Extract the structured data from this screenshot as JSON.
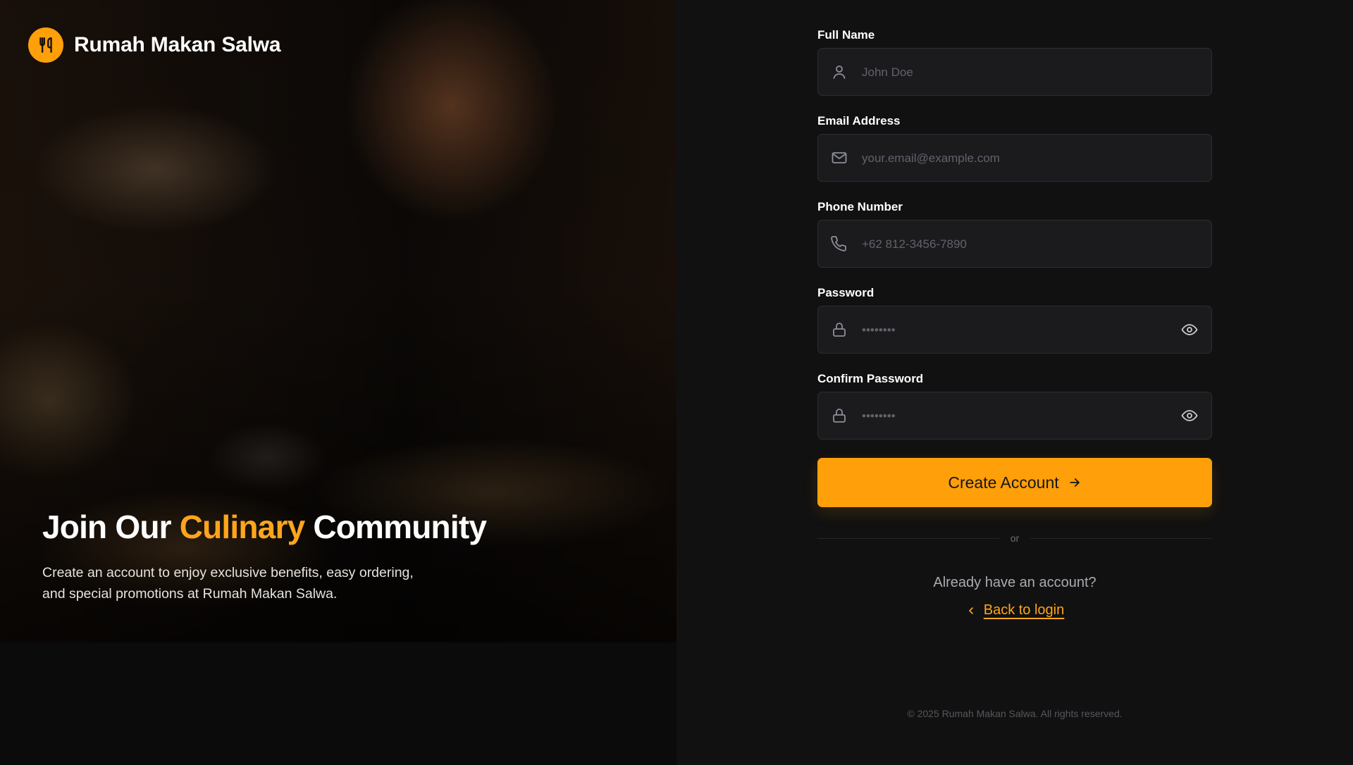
{
  "brand": {
    "name": "Rumah Makan Salwa",
    "logo_icon": "utensils-icon"
  },
  "hero": {
    "title_part1": "Join Our ",
    "title_accent": "Culinary",
    "title_part2": " Community",
    "subtitle_line1": "Create an account to enjoy exclusive benefits, easy ordering,",
    "subtitle_line2": "and special promotions at Rumah Makan Salwa."
  },
  "form": {
    "full_name": {
      "label": "Full Name",
      "placeholder": "John Doe",
      "icon": "user-icon"
    },
    "email": {
      "label": "Email Address",
      "placeholder": "your.email@example.com",
      "icon": "mail-icon"
    },
    "phone": {
      "label": "Phone Number",
      "placeholder": "+62 812-3456-7890",
      "icon": "phone-icon"
    },
    "password": {
      "label": "Password",
      "placeholder": "••••••••",
      "icon": "lock-icon"
    },
    "confirm_password": {
      "label": "Confirm Password",
      "placeholder": "••••••••",
      "icon": "lock-icon"
    },
    "submit_label": "Create Account",
    "divider_text": "or",
    "already_text": "Already have an account?",
    "back_link": "Back to login"
  },
  "footer": {
    "copyright": "© 2025 Rumah Makan Salwa. All rights reserved."
  },
  "colors": {
    "accent": "#ff9f0a",
    "background": "#111111",
    "input_bg": "#1b1b1e"
  }
}
